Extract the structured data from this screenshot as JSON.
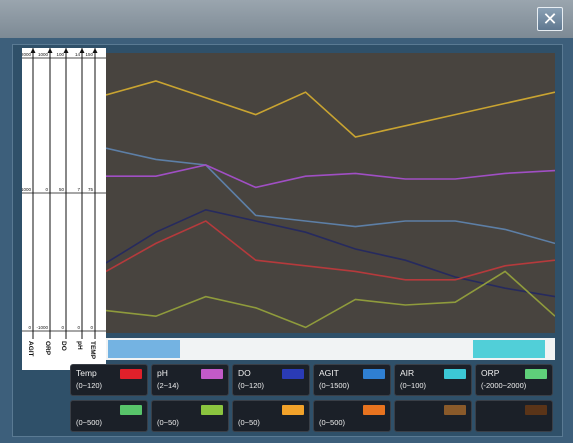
{
  "window": {
    "close_glyph": "✕"
  },
  "axes": [
    {
      "label": "AGIT",
      "ticks": [
        "2000",
        "1000",
        "0"
      ]
    },
    {
      "label": "ORP",
      "ticks": [
        "1000",
        "0",
        "-1000"
      ]
    },
    {
      "label": "DO",
      "ticks": [
        "100",
        "50",
        "0"
      ]
    },
    {
      "label": "pH",
      "ticks": [
        "14",
        "7",
        "0"
      ]
    },
    {
      "label": "TEMP",
      "ticks": [
        "150",
        "75",
        "0"
      ]
    }
  ],
  "chart_data": {
    "type": "line",
    "x": [
      0,
      1,
      2,
      3,
      4,
      5,
      6,
      7,
      8,
      9
    ],
    "series": [
      {
        "color": "#c9a431",
        "values": [
          0.85,
          0.9,
          0.84,
          0.78,
          0.86,
          0.7,
          0.74,
          0.78,
          0.82,
          0.86
        ]
      },
      {
        "color": "#5d7fa6",
        "values": [
          0.66,
          0.62,
          0.6,
          0.42,
          0.4,
          0.38,
          0.4,
          0.4,
          0.37,
          0.32
        ]
      },
      {
        "color": "#a04fc4",
        "values": [
          0.56,
          0.56,
          0.6,
          0.52,
          0.56,
          0.57,
          0.55,
          0.55,
          0.57,
          0.58
        ]
      },
      {
        "color": "#262a5e",
        "values": [
          0.25,
          0.36,
          0.44,
          0.4,
          0.36,
          0.3,
          0.26,
          0.2,
          0.16,
          0.13
        ]
      },
      {
        "color": "#b53a3c",
        "values": [
          0.22,
          0.32,
          0.4,
          0.26,
          0.24,
          0.22,
          0.19,
          0.19,
          0.24,
          0.26
        ]
      },
      {
        "color": "#8f9b3c",
        "values": [
          0.08,
          0.06,
          0.13,
          0.09,
          0.02,
          0.12,
          0.1,
          0.11,
          0.22,
          0.06
        ]
      }
    ]
  },
  "scrollbar": {
    "left_color": "#74b3e2",
    "right_color": "#51cfd8"
  },
  "legend": [
    {
      "name": "Temp",
      "range": "(0~120)",
      "color": "#e0202a"
    },
    {
      "name": "pH",
      "range": "(2~14)",
      "color": "#c25ac8"
    },
    {
      "name": "DO",
      "range": "(0~120)",
      "color": "#2a3bb6"
    },
    {
      "name": "AGIT",
      "range": "(0~1500)",
      "color": "#2f7fd2"
    },
    {
      "name": "AIR",
      "range": "(0~100)",
      "color": "#3cc8d6"
    },
    {
      "name": "ORP",
      "range": "(-2000~2000)",
      "color": "#5fd07a"
    },
    {
      "name": "",
      "range": "(0~500)",
      "color": "#58c46a"
    },
    {
      "name": "",
      "range": "(0~50)",
      "color": "#8bc43f"
    },
    {
      "name": "",
      "range": "(0~50)",
      "color": "#f2a22a"
    },
    {
      "name": "",
      "range": "(0~500)",
      "color": "#e8731f"
    },
    {
      "name": "",
      "range": "",
      "color": "#8a5a2a"
    },
    {
      "name": "",
      "range": "",
      "color": "#5a3418"
    }
  ]
}
